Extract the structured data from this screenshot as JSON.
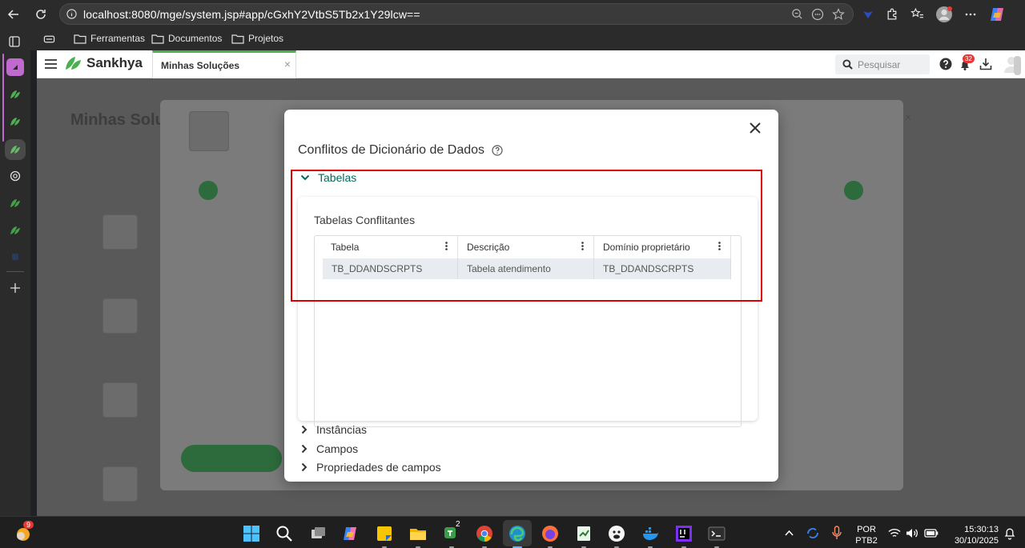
{
  "browser": {
    "url": "localhost:8080/mge/system.jsp#app/cGxhY2VtbS5Tb2x1Y29lcw==",
    "bookmarks": [
      "Ferramentas",
      "Documentos",
      "Projetos"
    ]
  },
  "app": {
    "brand": "Sankhya",
    "tab_label": "Minhas Soluções",
    "tab_close": "×",
    "search_placeholder": "Pesquisar",
    "notification_count": "32"
  },
  "modal": {
    "title": "Conflitos de Dicionário de Dados",
    "close": "✕",
    "sections": {
      "tabelas": "Tabelas",
      "instancias": "Instâncias",
      "campos": "Campos",
      "propriedades": "Propriedades de campos"
    },
    "card_title": "Tabelas Conflitantes",
    "grid": {
      "columns": [
        "Tabela",
        "Descrição",
        "Domínio proprietário"
      ],
      "rows": [
        [
          "TB_DDANDSCRPTS",
          "Tabela atendimento",
          "TB_DDANDSCRPTS"
        ]
      ]
    }
  },
  "taskbar": {
    "weather_badge": "9",
    "teams_badge": "2",
    "lang_line1": "POR",
    "lang_line2": "PTB2",
    "time": "15:30:13",
    "date": "30/10/2025"
  },
  "colors": {
    "accent_green": "#4caf50",
    "section_active": "#00695c",
    "highlight_red": "#e00000"
  }
}
